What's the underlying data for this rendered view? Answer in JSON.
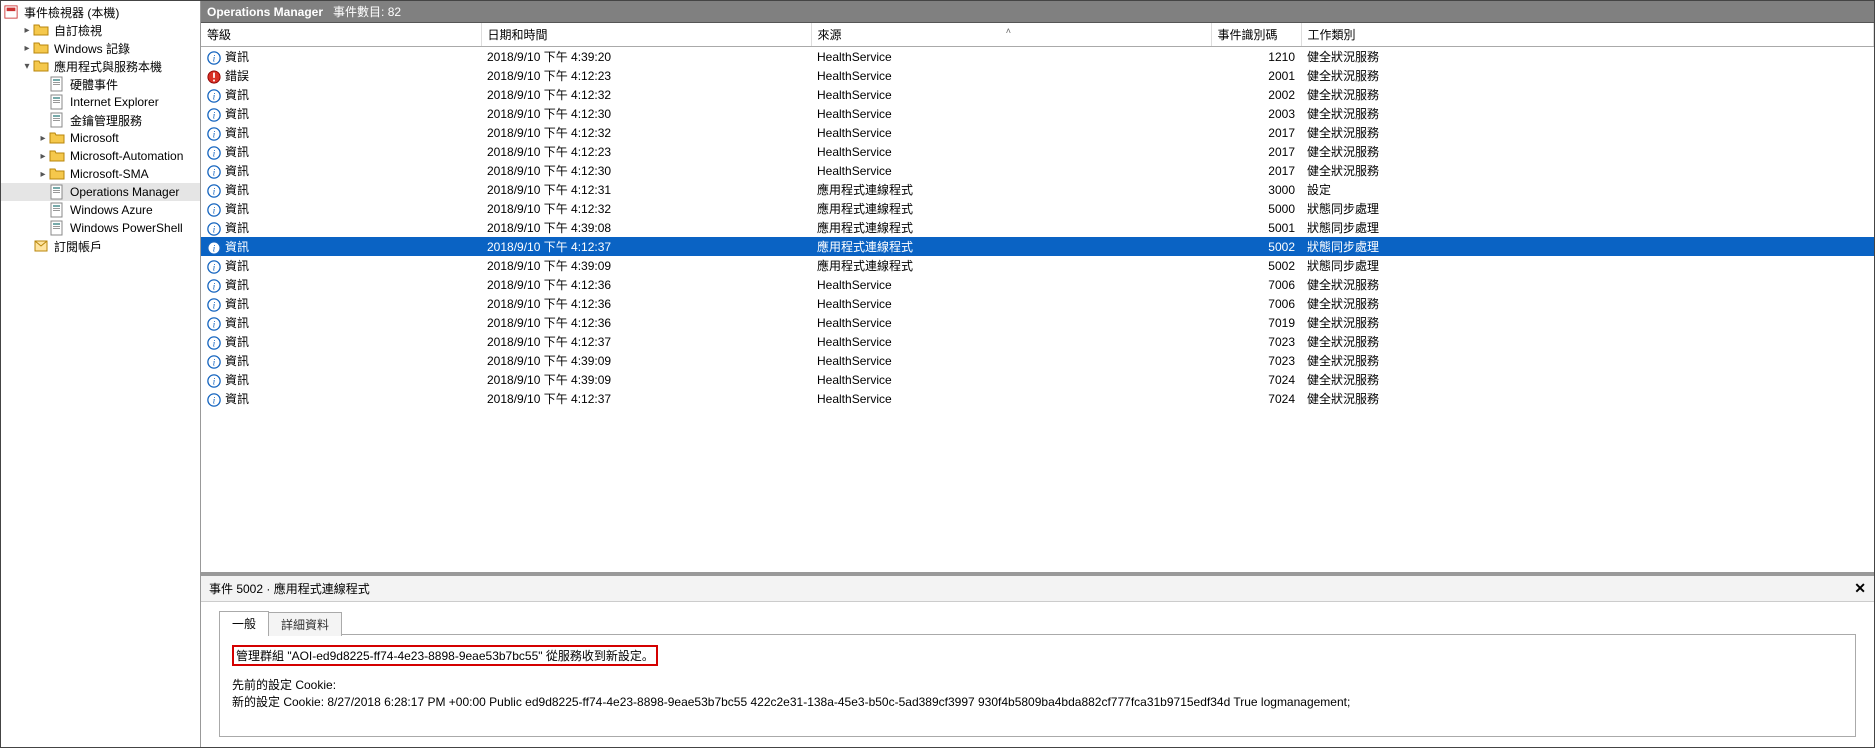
{
  "tree": {
    "root": "事件檢視器 (本機)",
    "items": [
      {
        "indent": 1,
        "twisty": ">",
        "icon": "folder-star",
        "label": "自訂檢視"
      },
      {
        "indent": 1,
        "twisty": ">",
        "icon": "folder",
        "label": "Windows 記錄"
      },
      {
        "indent": 1,
        "twisty": "v",
        "icon": "folder",
        "label": "應用程式與服務本機"
      },
      {
        "indent": 2,
        "twisty": "",
        "icon": "log",
        "label": "硬體事件"
      },
      {
        "indent": 2,
        "twisty": "",
        "icon": "log",
        "label": "Internet Explorer"
      },
      {
        "indent": 2,
        "twisty": "",
        "icon": "log",
        "label": "金鑰管理服務"
      },
      {
        "indent": 2,
        "twisty": ">",
        "icon": "folder",
        "label": "Microsoft"
      },
      {
        "indent": 2,
        "twisty": ">",
        "icon": "folder",
        "label": "Microsoft-Automation"
      },
      {
        "indent": 2,
        "twisty": ">",
        "icon": "folder",
        "label": "Microsoft-SMA"
      },
      {
        "indent": 2,
        "twisty": "",
        "icon": "log",
        "label": "Operations Manager",
        "selected": true
      },
      {
        "indent": 2,
        "twisty": "",
        "icon": "log",
        "label": "Windows Azure"
      },
      {
        "indent": 2,
        "twisty": "",
        "icon": "log",
        "label": "Windows PowerShell"
      },
      {
        "indent": 1,
        "twisty": "",
        "icon": "subs",
        "label": "訂閱帳戶"
      }
    ]
  },
  "header": {
    "title": "Operations Manager",
    "count_label": "事件數目: 82"
  },
  "columns": {
    "level": "等級",
    "datetime": "日期和時間",
    "source": "來源",
    "eventid": "事件識別碼",
    "category": "工作類別"
  },
  "rows": [
    {
      "lvl": "info",
      "level": "資訊",
      "dt": "2018/9/10 下午 4:39:20",
      "src": "HealthService",
      "id": "1210",
      "cat": "健全狀況服務"
    },
    {
      "lvl": "error",
      "level": "錯誤",
      "dt": "2018/9/10 下午 4:12:23",
      "src": "HealthService",
      "id": "2001",
      "cat": "健全狀況服務"
    },
    {
      "lvl": "info",
      "level": "資訊",
      "dt": "2018/9/10 下午 4:12:32",
      "src": "HealthService",
      "id": "2002",
      "cat": "健全狀況服務"
    },
    {
      "lvl": "info",
      "level": "資訊",
      "dt": "2018/9/10 下午 4:12:30",
      "src": "HealthService",
      "id": "2003",
      "cat": "健全狀況服務"
    },
    {
      "lvl": "info",
      "level": "資訊",
      "dt": "2018/9/10 下午 4:12:32",
      "src": "HealthService",
      "id": "2017",
      "cat": "健全狀況服務"
    },
    {
      "lvl": "info",
      "level": "資訊",
      "dt": "2018/9/10 下午 4:12:23",
      "src": "HealthService",
      "id": "2017",
      "cat": "健全狀況服務"
    },
    {
      "lvl": "info",
      "level": "資訊",
      "dt": "2018/9/10 下午 4:12:30",
      "src": "HealthService",
      "id": "2017",
      "cat": "健全狀況服務"
    },
    {
      "lvl": "info",
      "level": "資訊",
      "dt": "2018/9/10 下午 4:12:31",
      "src": "應用程式連線程式",
      "id": "3000",
      "cat": "設定"
    },
    {
      "lvl": "info",
      "level": "資訊",
      "dt": "2018/9/10 下午 4:12:32",
      "src": "應用程式連線程式",
      "id": "5000",
      "cat": "狀態同步處理"
    },
    {
      "lvl": "info",
      "level": "資訊",
      "dt": "2018/9/10 下午 4:39:08",
      "src": "應用程式連線程式",
      "id": "5001",
      "cat": "狀態同步處理"
    },
    {
      "lvl": "info",
      "level": "資訊",
      "dt": "2018/9/10 下午 4:12:37",
      "src": "應用程式連線程式",
      "id": "5002",
      "cat": "狀態同步處理",
      "selected": true
    },
    {
      "lvl": "info",
      "level": "資訊",
      "dt": "2018/9/10 下午 4:39:09",
      "src": "應用程式連線程式",
      "id": "5002",
      "cat": "狀態同步處理"
    },
    {
      "lvl": "info",
      "level": "資訊",
      "dt": "2018/9/10 下午 4:12:36",
      "src": "HealthService",
      "id": "7006",
      "cat": "健全狀況服務"
    },
    {
      "lvl": "info",
      "level": "資訊",
      "dt": "2018/9/10 下午 4:12:36",
      "src": "HealthService",
      "id": "7006",
      "cat": "健全狀況服務"
    },
    {
      "lvl": "info",
      "level": "資訊",
      "dt": "2018/9/10 下午 4:12:36",
      "src": "HealthService",
      "id": "7019",
      "cat": "健全狀況服務"
    },
    {
      "lvl": "info",
      "level": "資訊",
      "dt": "2018/9/10 下午 4:12:37",
      "src": "HealthService",
      "id": "7023",
      "cat": "健全狀況服務"
    },
    {
      "lvl": "info",
      "level": "資訊",
      "dt": "2018/9/10 下午 4:39:09",
      "src": "HealthService",
      "id": "7023",
      "cat": "健全狀況服務"
    },
    {
      "lvl": "info",
      "level": "資訊",
      "dt": "2018/9/10 下午 4:39:09",
      "src": "HealthService",
      "id": "7024",
      "cat": "健全狀況服務"
    },
    {
      "lvl": "info",
      "level": "資訊",
      "dt": "2018/9/10 下午 4:12:37",
      "src": "HealthService",
      "id": "7024",
      "cat": "健全狀況服務"
    }
  ],
  "detail": {
    "title": "事件 5002 · 應用程式連線程式",
    "tab_general": "一般",
    "tab_details": "詳細資料",
    "highlight": "管理群組 \"AOI-ed9d8225-ff74-4e23-8898-9eae53b7bc55\" 從服務收到新設定。",
    "line1": "先前的設定 Cookie:",
    "line2": "新的設定 Cookie: 8/27/2018 6:28:17 PM +00:00 Public ed9d8225-ff74-4e23-8898-9eae53b7bc55 422c2e31-138a-45e3-b50c-5ad389cf3997 930f4b5809ba4bda882cf777fca31b9715edf34d True logmanagement;"
  }
}
